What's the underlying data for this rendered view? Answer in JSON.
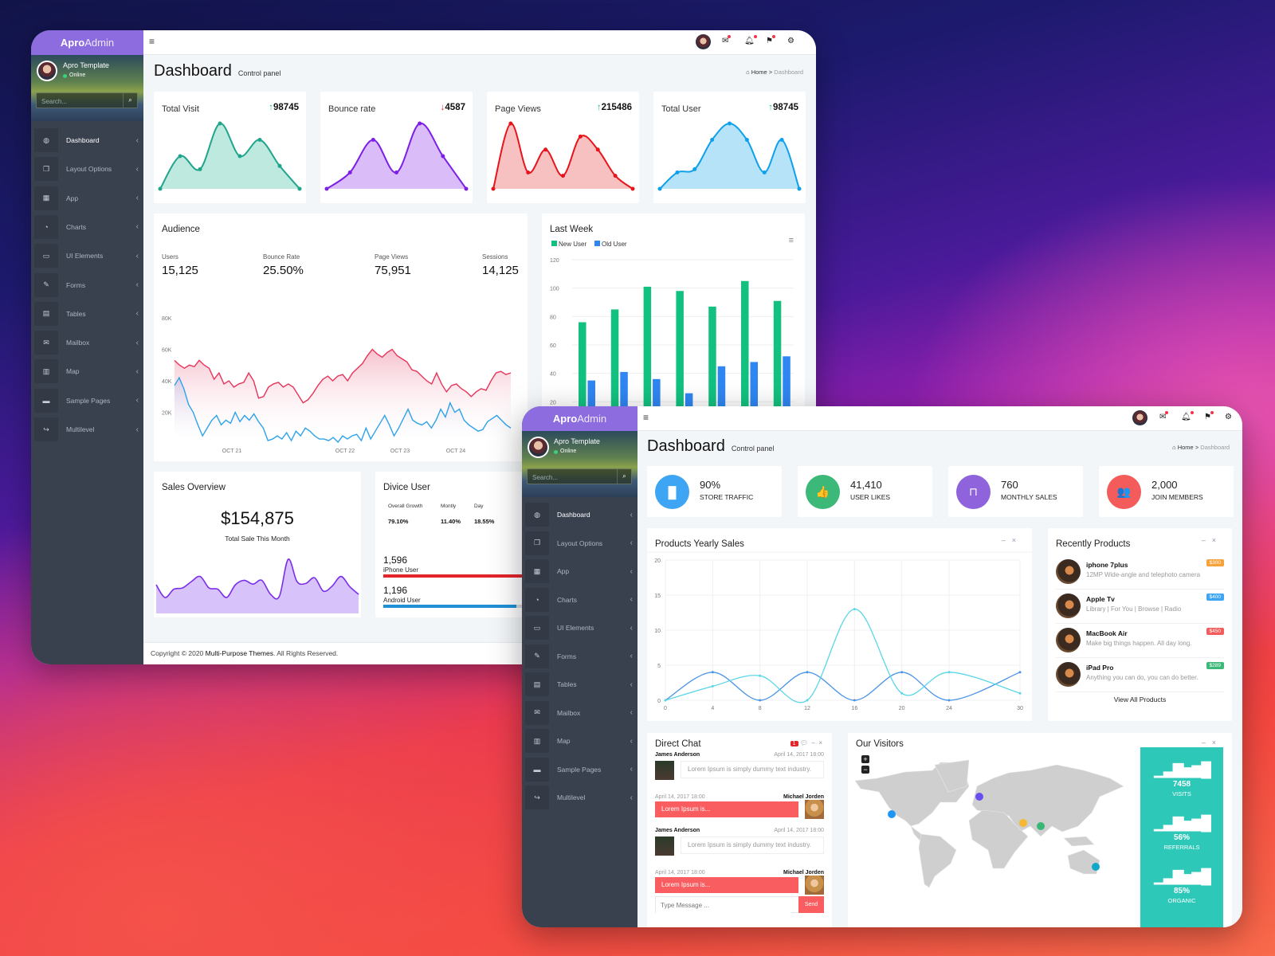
{
  "brand": {
    "bold": "Apro",
    "light": "Admin"
  },
  "profile": {
    "name": "Apro Template",
    "status": "Online"
  },
  "search": {
    "placeholder": "Search..."
  },
  "sidebar": {
    "items": [
      {
        "label": "Dashboard",
        "icon": "dashboard-icon",
        "glyph": "◍"
      },
      {
        "label": "Layout Options",
        "icon": "layout-icon",
        "glyph": "❐"
      },
      {
        "label": "App",
        "icon": "grid-icon",
        "glyph": "▦"
      },
      {
        "label": "Charts",
        "icon": "pie-chart-icon",
        "glyph": "◔"
      },
      {
        "label": "UI Elements",
        "icon": "laptop-icon",
        "glyph": "▭"
      },
      {
        "label": "Forms",
        "icon": "edit-icon",
        "glyph": "✎"
      },
      {
        "label": "Tables",
        "icon": "table-icon",
        "glyph": "▤"
      },
      {
        "label": "Mailbox",
        "icon": "envelope-icon",
        "glyph": "✉"
      },
      {
        "label": "Map",
        "icon": "map-icon",
        "glyph": "▥"
      },
      {
        "label": "Sample Pages",
        "icon": "folder-icon",
        "glyph": "▬"
      },
      {
        "label": "Multilevel",
        "icon": "share-icon",
        "glyph": "↪"
      }
    ]
  },
  "header": {
    "icons": [
      "user-avatar",
      "envelope-icon",
      "bell-icon",
      "flag-icon",
      "gear-icon"
    ]
  },
  "page": {
    "title": "Dashboard",
    "subtitle": "Control panel",
    "breadcrumb_home": "Home",
    "breadcrumb_sep": ">",
    "breadcrumb_current": "Dashboard"
  },
  "back": {
    "stats": [
      {
        "title": "Total Visit",
        "value": "98745",
        "trend": "up",
        "color": "#1fa58b",
        "fill": "#bde9df"
      },
      {
        "title": "Bounce rate",
        "value": "4587",
        "trend": "down",
        "color": "#7d1fe6",
        "fill": "#d9bcf8"
      },
      {
        "title": "Page Views",
        "value": "215486",
        "trend": "up",
        "color": "#e8141b",
        "fill": "#f7c1c1"
      },
      {
        "title": "Total User",
        "value": "98745",
        "trend": "up",
        "color": "#0fa0ec",
        "fill": "#b7e3f9"
      }
    ],
    "audience": {
      "title": "Audience",
      "metrics": [
        {
          "label": "Users",
          "value": "15,125"
        },
        {
          "label": "Bounce Rate",
          "value": "25.50%"
        },
        {
          "label": "Page Views",
          "value": "75,951"
        },
        {
          "label": "Sessions",
          "value": "14,125"
        }
      ]
    },
    "last_week": {
      "title": "Last Week"
    },
    "sales": {
      "title": "Sales Overview",
      "amount": "$154,875",
      "caption": "Total Sale This Month"
    },
    "device": {
      "title": "Divice User",
      "growth": [
        {
          "label": "Overall Growth",
          "value": "79.10%"
        },
        {
          "label": "Montly",
          "value": "11.40%"
        },
        {
          "label": "Day",
          "value": "18.55%"
        }
      ],
      "users": [
        {
          "value": "1,596",
          "label": "iPhone User",
          "percent": 100,
          "color": "#e3242b"
        },
        {
          "value": "1,196",
          "label": "Android User",
          "percent": 55,
          "color": "#1e90d6"
        }
      ]
    },
    "footer": {
      "prefix": "Copyright © 2020 ",
      "company": "Multi-Purpose Themes",
      "suffix": ". All Rights Reserved."
    }
  },
  "front": {
    "info": [
      {
        "value": "90%",
        "label": "STORE TRAFFIC",
        "icon": "bar-chart-icon",
        "glyph": "▐▌",
        "color": "#3da5f4"
      },
      {
        "value": "41,410",
        "label": "USER LIKES",
        "icon": "thumbs-up-icon",
        "glyph": "👍",
        "color": "#3cb878"
      },
      {
        "value": "760",
        "label": "MONTHLY SALES",
        "icon": "shopping-bag-icon",
        "glyph": "⊓",
        "color": "#8e63dc"
      },
      {
        "value": "2,000",
        "label": "JOIN MEMBERS",
        "icon": "users-icon",
        "glyph": "👥",
        "color": "#f45b5b"
      }
    ],
    "yearly": {
      "title": "Products Yearly Sales"
    },
    "recent": {
      "title": "Recently Products",
      "view_all": "View All Products",
      "items": [
        {
          "name": "iphone 7plus",
          "desc": "12MP Wide-angle and telephoto camera",
          "price": "$300",
          "color": "#f7a13a"
        },
        {
          "name": "Apple Tv",
          "desc": "Library | For You | Browse | Radio",
          "price": "$400",
          "color": "#3da5f4"
        },
        {
          "name": "MacBook Air",
          "desc": "Make big things happen. All day long.",
          "price": "$450",
          "color": "#f45b5b"
        },
        {
          "name": "iPad Pro",
          "desc": "Anything you can do, you can do better.",
          "price": "$289",
          "color": "#3cb878"
        }
      ]
    },
    "chat": {
      "title": "Direct Chat",
      "badge": "1",
      "placeholder": "Type Message ...",
      "send": "Send",
      "messages": [
        {
          "side": "left",
          "name": "James Anderson",
          "time": "April 14, 2017 18:00",
          "text": "Lorem Ipsum is simply dummy text industry."
        },
        {
          "side": "right",
          "name": "Michael Jorden",
          "time": "April 14, 2017 18:00",
          "text": "Lorem Ipsum is..."
        },
        {
          "side": "left",
          "name": "James Anderson",
          "time": "April 14, 2017 18:00",
          "text": "Lorem Ipsum is simply dummy text industry."
        },
        {
          "side": "right",
          "name": "Michael Jorden",
          "time": "April 14, 2017 18:00",
          "text": "Lorem Ipsum is..."
        }
      ]
    },
    "visitors": {
      "title": "Our Visitors",
      "zoom_in": "+",
      "zoom_out": "−",
      "markers": [
        {
          "place": "western-us",
          "color": "#1e96f5"
        },
        {
          "place": "uk",
          "color": "#6a4df0"
        },
        {
          "place": "middle-east",
          "color": "#f7b733"
        },
        {
          "place": "india",
          "color": "#37b877"
        },
        {
          "place": "australia",
          "color": "#10a8c8"
        }
      ],
      "stats": [
        {
          "value": "7458",
          "label": "VISITS"
        },
        {
          "value": "56%",
          "label": "REFERRALS"
        },
        {
          "value": "85%",
          "label": "ORGANIC"
        }
      ],
      "panel_color": "#2ec8b8"
    }
  },
  "chart_data": [
    {
      "type": "area",
      "name": "Total Visit",
      "values": [
        0,
        50,
        30,
        100,
        50,
        75,
        35,
        0
      ]
    },
    {
      "type": "area",
      "name": "Bounce rate",
      "values": [
        0,
        25,
        75,
        25,
        100,
        50,
        0
      ]
    },
    {
      "type": "area",
      "name": "Page Views",
      "values": [
        0,
        100,
        25,
        60,
        20,
        80,
        60,
        20,
        0
      ]
    },
    {
      "type": "area",
      "name": "Total User",
      "values": [
        0,
        25,
        30,
        75,
        100,
        75,
        25,
        75,
        0
      ]
    },
    {
      "type": "area",
      "title": "Audience",
      "ylim": [
        0,
        80000
      ],
      "yticks": [
        "20K",
        "40K",
        "60K",
        "80K"
      ],
      "xticks": [
        "OCT 21",
        "OCT 22",
        "OCT 23",
        "OCT 24"
      ],
      "series": [
        {
          "color": "#e8345a",
          "values": [
            53,
            50,
            48,
            50,
            49,
            53,
            50,
            48,
            41,
            45,
            38,
            40,
            36,
            38,
            39,
            45,
            40,
            29,
            30,
            36,
            38,
            39,
            36,
            38,
            36,
            31,
            26,
            28,
            32,
            37,
            41,
            43,
            40,
            43,
            44,
            40,
            45,
            48,
            51,
            56,
            60,
            57,
            55,
            58,
            60,
            56,
            54,
            52,
            47,
            46,
            43,
            40,
            38,
            45,
            38,
            33,
            37,
            38,
            35,
            33,
            30,
            33,
            35,
            34,
            40,
            45,
            46,
            44,
            45
          ]
        },
        {
          "color": "#2ea3e8",
          "values": [
            37,
            42,
            35,
            25,
            20,
            12,
            5,
            10,
            15,
            18,
            12,
            15,
            13,
            20,
            14,
            18,
            15,
            19,
            14,
            10,
            2,
            3,
            5,
            3,
            7,
            2,
            8,
            5,
            10,
            8,
            5,
            3,
            3,
            2,
            4,
            1,
            5,
            3,
            5,
            6,
            2,
            10,
            3,
            8,
            13,
            18,
            12,
            5,
            10,
            16,
            22,
            15,
            13,
            12,
            14,
            10,
            15,
            22,
            17,
            26,
            20,
            22,
            15,
            12,
            10,
            8,
            9,
            14,
            16,
            18,
            15,
            12,
            10
          ]
        }
      ]
    },
    {
      "type": "bar",
      "title": "Last Week",
      "ylim": [
        0,
        120
      ],
      "yticks": [
        20,
        40,
        60,
        80,
        100,
        120
      ],
      "legend": "top-left",
      "series": [
        {
          "name": "New User",
          "color": "#12c17f",
          "values": [
            76,
            85,
            101,
            98,
            87,
            105,
            91
          ]
        },
        {
          "name": "Old User",
          "color": "#2f86f2",
          "values": [
            35,
            41,
            36,
            26,
            45,
            48,
            52
          ]
        }
      ]
    },
    {
      "type": "area",
      "title": "Sales Overview",
      "color": "#7b2ee8",
      "fill": "#d8c2fa",
      "values": [
        45,
        25,
        38,
        40,
        50,
        58,
        40,
        38,
        25,
        45,
        52,
        46,
        52,
        30,
        27,
        85,
        50,
        47,
        56,
        35,
        43,
        58,
        42,
        30
      ]
    },
    {
      "type": "line",
      "title": "Products Yearly Sales",
      "x": [
        0,
        4,
        8,
        12,
        16,
        20,
        24,
        30
      ],
      "ylim": [
        0,
        20
      ],
      "yticks": [
        0,
        5,
        10,
        15,
        20
      ],
      "grid": true,
      "series": [
        {
          "color": "#4a94e8",
          "values": [
            0,
            4,
            0,
            4,
            0,
            4,
            0,
            4
          ]
        },
        {
          "color": "#5bd6e8",
          "values": [
            0,
            2,
            3.5,
            0,
            13,
            1,
            4,
            1
          ]
        }
      ]
    }
  ]
}
